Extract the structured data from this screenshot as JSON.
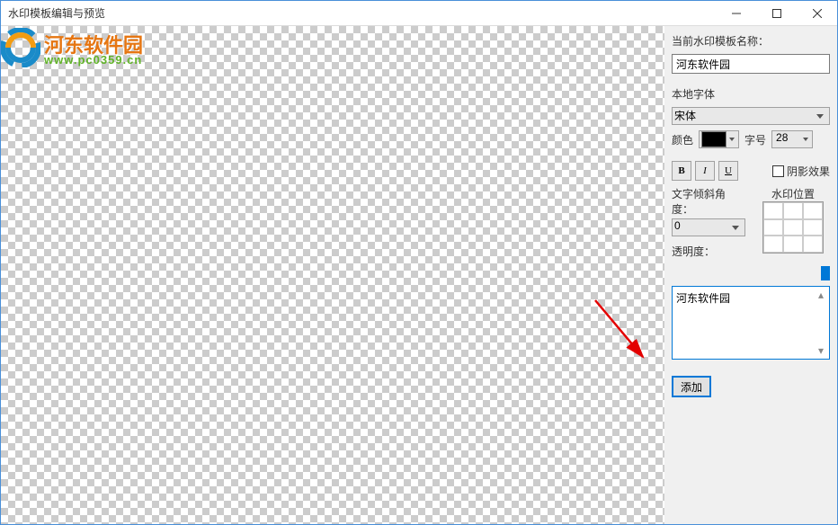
{
  "window": {
    "title": "水印模板编辑与预览"
  },
  "logo": {
    "text": "河东软件园",
    "url": "www.pc0359.cn"
  },
  "sidebar": {
    "template_name_label": "当前水印模板名称：",
    "template_name_value": "河东软件园",
    "font_label": "本地字体",
    "font_value": "宋体",
    "color_label": "颜色",
    "color_value": "#000000",
    "size_label": "字号",
    "size_value": "28",
    "bold": "B",
    "italic": "I",
    "underline": "U",
    "shadow_label": "阴影效果",
    "angle_label": "文字倾斜角度：",
    "angle_value": "0",
    "position_label": "水印位置",
    "opacity_label": "透明度：",
    "text_content": "河东软件园",
    "add_button": "添加"
  }
}
